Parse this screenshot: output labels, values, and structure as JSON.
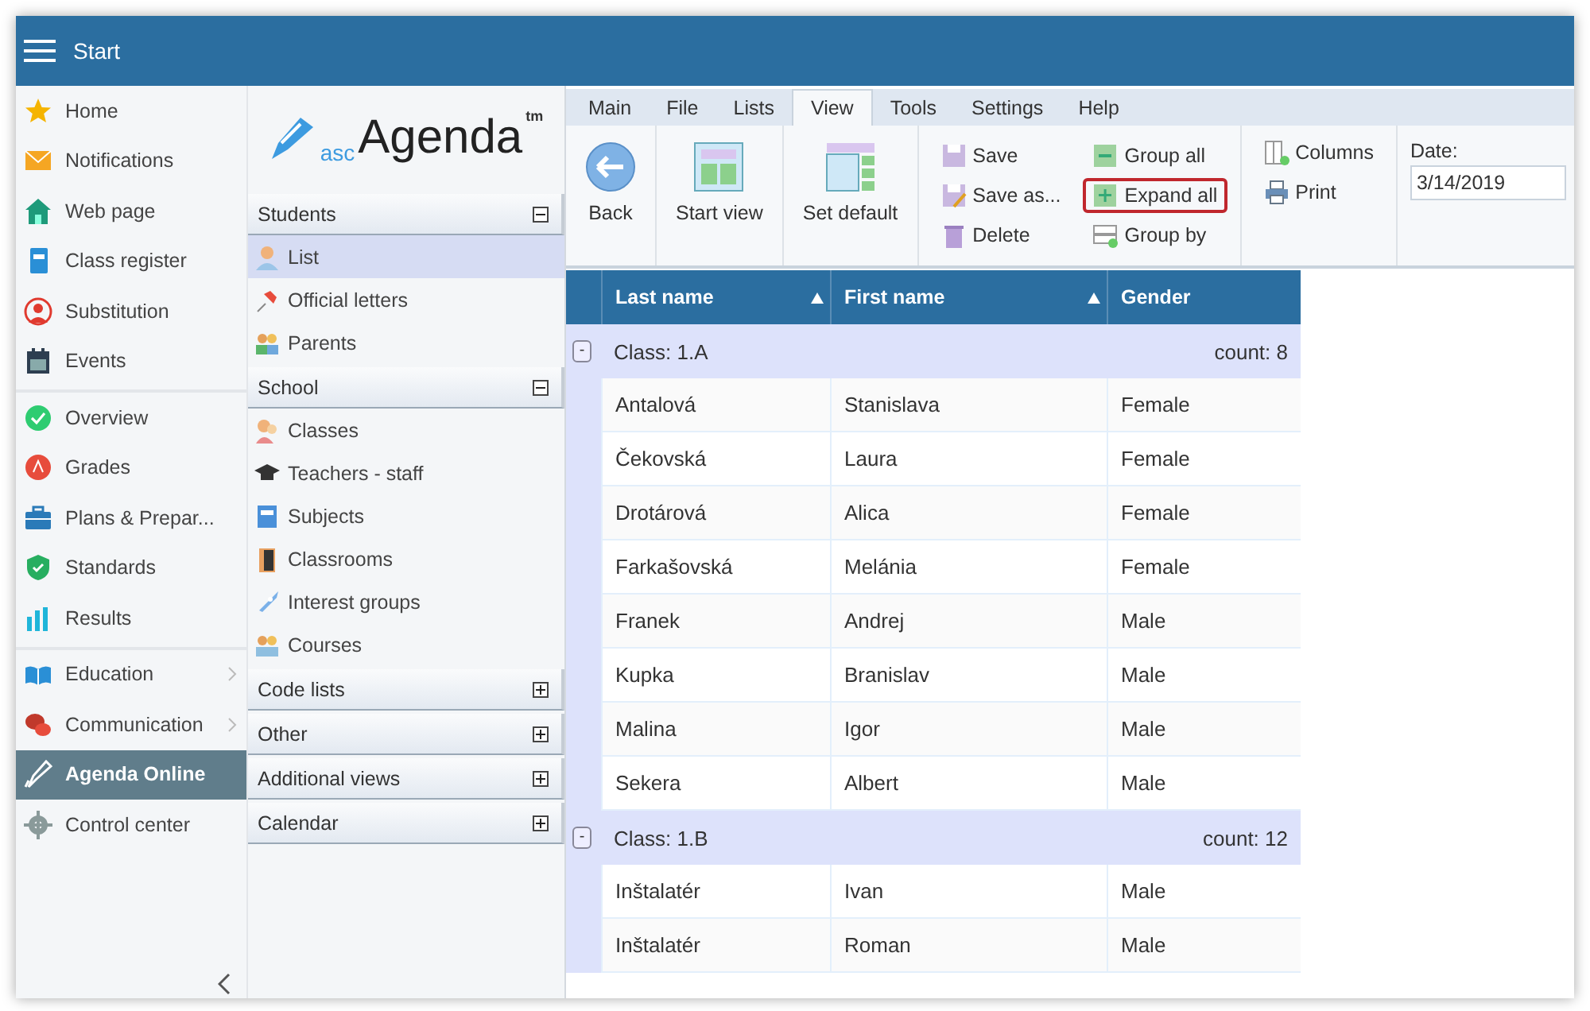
{
  "header": {
    "title": "Start"
  },
  "sidebar": {
    "groups": [
      {
        "items": [
          {
            "label": "Home",
            "selected": false,
            "submenu": false
          },
          {
            "label": "Notifications",
            "selected": false,
            "submenu": false
          },
          {
            "label": "Web page",
            "selected": false,
            "submenu": false
          },
          {
            "label": "Class register",
            "selected": false,
            "submenu": false
          },
          {
            "label": "Substitution",
            "selected": false,
            "submenu": false
          },
          {
            "label": "Events",
            "selected": false,
            "submenu": false
          }
        ]
      },
      {
        "items": [
          {
            "label": "Overview",
            "selected": false,
            "submenu": false
          },
          {
            "label": "Grades",
            "selected": false,
            "submenu": false
          },
          {
            "label": "Plans & Prepar...",
            "selected": false,
            "submenu": false
          },
          {
            "label": "Standards",
            "selected": false,
            "submenu": false
          },
          {
            "label": "Results",
            "selected": false,
            "submenu": false
          }
        ]
      },
      {
        "items": [
          {
            "label": "Education",
            "selected": false,
            "submenu": true
          },
          {
            "label": "Communication",
            "selected": false,
            "submenu": true
          },
          {
            "label": "Agenda Online",
            "selected": true,
            "submenu": false
          },
          {
            "label": "Control center",
            "selected": false,
            "submenu": false
          }
        ]
      }
    ]
  },
  "logo": {
    "prefix": "asc",
    "name": "Agenda",
    "mark": "tm"
  },
  "sections": [
    {
      "title": "Students",
      "expanded": true,
      "items": [
        {
          "label": "List",
          "selected": true
        },
        {
          "label": "Official letters",
          "selected": false
        },
        {
          "label": "Parents",
          "selected": false
        }
      ]
    },
    {
      "title": "School",
      "expanded": true,
      "items": [
        {
          "label": "Classes",
          "selected": false
        },
        {
          "label": "Teachers - staff",
          "selected": false
        },
        {
          "label": "Subjects",
          "selected": false
        },
        {
          "label": "Classrooms",
          "selected": false
        },
        {
          "label": "Interest groups",
          "selected": false
        },
        {
          "label": "Courses",
          "selected": false
        }
      ]
    },
    {
      "title": "Code lists",
      "expanded": false
    },
    {
      "title": "Other",
      "expanded": false
    },
    {
      "title": "Additional views",
      "expanded": false
    },
    {
      "title": "Calendar",
      "expanded": false
    }
  ],
  "ribbon": {
    "tabs": [
      {
        "label": "Main",
        "selected": false
      },
      {
        "label": "File",
        "selected": false
      },
      {
        "label": "Lists",
        "selected": false
      },
      {
        "label": "View",
        "selected": true
      },
      {
        "label": "Tools",
        "selected": false
      },
      {
        "label": "Settings",
        "selected": false
      },
      {
        "label": "Help",
        "selected": false
      }
    ],
    "groups": [
      {
        "kind": "large",
        "buttons": [
          {
            "label": "Back"
          }
        ]
      },
      {
        "kind": "large",
        "buttons": [
          {
            "label": "Start view"
          }
        ]
      },
      {
        "kind": "large",
        "buttons": [
          {
            "label": "Set default"
          }
        ]
      },
      {
        "kind": "small",
        "buttons": [
          {
            "label": "Save",
            "highlighted": false
          },
          {
            "label": "Save as...",
            "highlighted": false
          },
          {
            "label": "Delete",
            "highlighted": false
          }
        ]
      },
      {
        "kind": "small",
        "buttons": [
          {
            "label": "Group all",
            "highlighted": false
          },
          {
            "label": "Expand all",
            "highlighted": true
          },
          {
            "label": "Group by",
            "highlighted": false
          }
        ]
      },
      {
        "kind": "small",
        "buttons": [
          {
            "label": "Columns",
            "highlighted": false
          },
          {
            "label": "Print",
            "highlighted": false
          }
        ]
      },
      {
        "kind": "field",
        "label": "Date:",
        "value": "3/14/2019"
      }
    ]
  },
  "table": {
    "columns": [
      {
        "label": "Last name",
        "sorted": true
      },
      {
        "label": "First name",
        "sorted": true
      },
      {
        "label": "Gender",
        "sorted": false
      }
    ],
    "groups": [
      {
        "label": "Class: 1.A",
        "count": "count: 8",
        "toggle": "-",
        "expanded": true,
        "rows": [
          [
            "Antalová",
            "Stanislava",
            "Female"
          ],
          [
            "Čekovská",
            "Laura",
            "Female"
          ],
          [
            "Drotárová",
            "Alica",
            "Female"
          ],
          [
            "Farkašovská",
            "Melánia",
            "Female"
          ],
          [
            "Franek",
            "Andrej",
            "Male"
          ],
          [
            "Kupka",
            "Branislav",
            "Male"
          ],
          [
            "Malina",
            "Igor",
            "Male"
          ],
          [
            "Sekera",
            "Albert",
            "Male"
          ]
        ]
      },
      {
        "label": "Class: 1.B",
        "count": "count: 12",
        "toggle": "-",
        "expanded": true,
        "rows": [
          [
            "Inštalatér",
            "Ivan",
            "Male"
          ],
          [
            "Inštalatér",
            "Roman",
            "Male"
          ]
        ]
      }
    ]
  }
}
